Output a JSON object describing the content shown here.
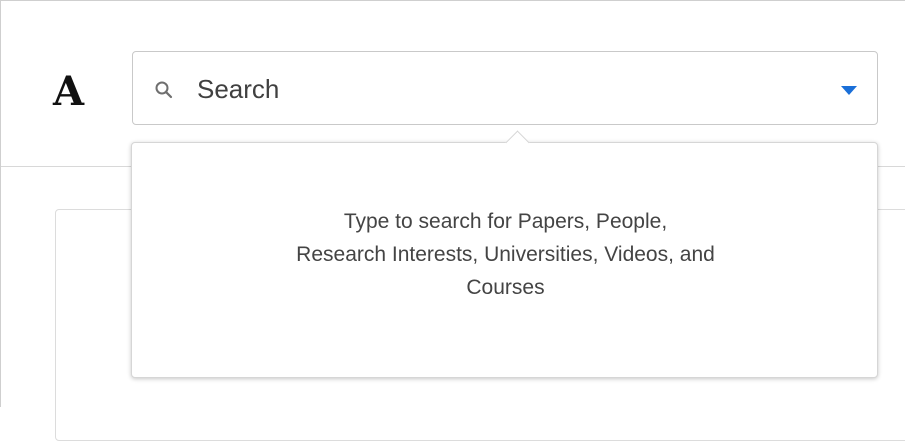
{
  "header": {
    "logo_text": "A",
    "search": {
      "placeholder": "Search",
      "value": ""
    },
    "colors": {
      "caret": "#1a6fd8"
    }
  },
  "popover": {
    "hint_lines": [
      "Type to search for Papers, People,",
      "Research Interests, Universities, Videos, and",
      "Courses"
    ]
  },
  "icons": {
    "search": "search-icon",
    "dropdown": "caret-down-icon"
  }
}
